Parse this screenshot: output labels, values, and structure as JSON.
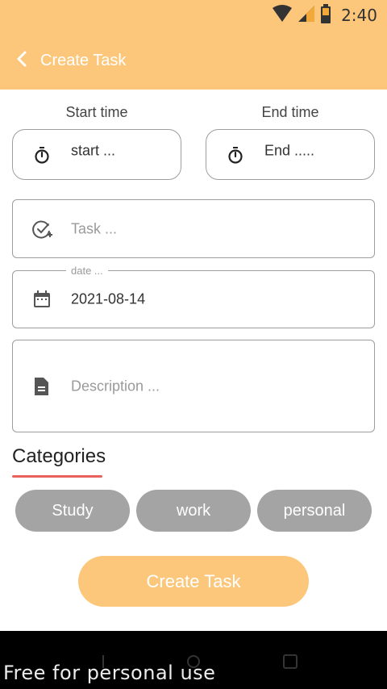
{
  "status_bar": {
    "time": "2:40"
  },
  "header": {
    "title": "Create Task"
  },
  "form": {
    "start": {
      "label": "Start time",
      "placeholder": "start ..."
    },
    "end": {
      "label": "End time",
      "placeholder": "End ....."
    },
    "task": {
      "placeholder": "Task ..."
    },
    "date": {
      "legend": "date ...",
      "value": "2021-08-14"
    },
    "description": {
      "placeholder": "Description ..."
    }
  },
  "categories": {
    "title": "Categories",
    "items": [
      "Study",
      "work",
      "personal"
    ]
  },
  "primary_button": "Create Task",
  "watermark": "Free for personal use",
  "colors": {
    "accent": "#fcc77a",
    "chip": "#a4a4a4",
    "underline": "#e8615c"
  }
}
